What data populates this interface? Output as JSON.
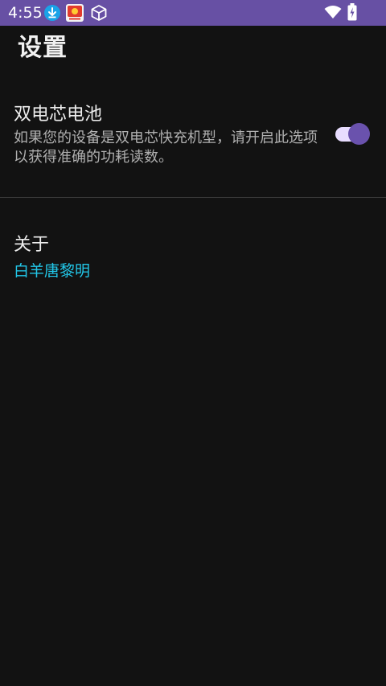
{
  "status_bar": {
    "time": "4:55",
    "icons": [
      "download-icon",
      "app-notification-icon",
      "cube-icon",
      "wifi-icon",
      "battery-charging-icon"
    ],
    "background_color": "#6750a4"
  },
  "page": {
    "title": "设置"
  },
  "preferences": {
    "dual_cell": {
      "title": "双电芯电池",
      "summary": "如果您的设备是双电芯快充机型，请开启此选项以获得准确的功耗读数。",
      "enabled": true,
      "accent_color": "#6a52ad"
    },
    "about": {
      "title": "关于",
      "value": "白羊唐黎明",
      "value_color": "#22c7e8"
    }
  }
}
